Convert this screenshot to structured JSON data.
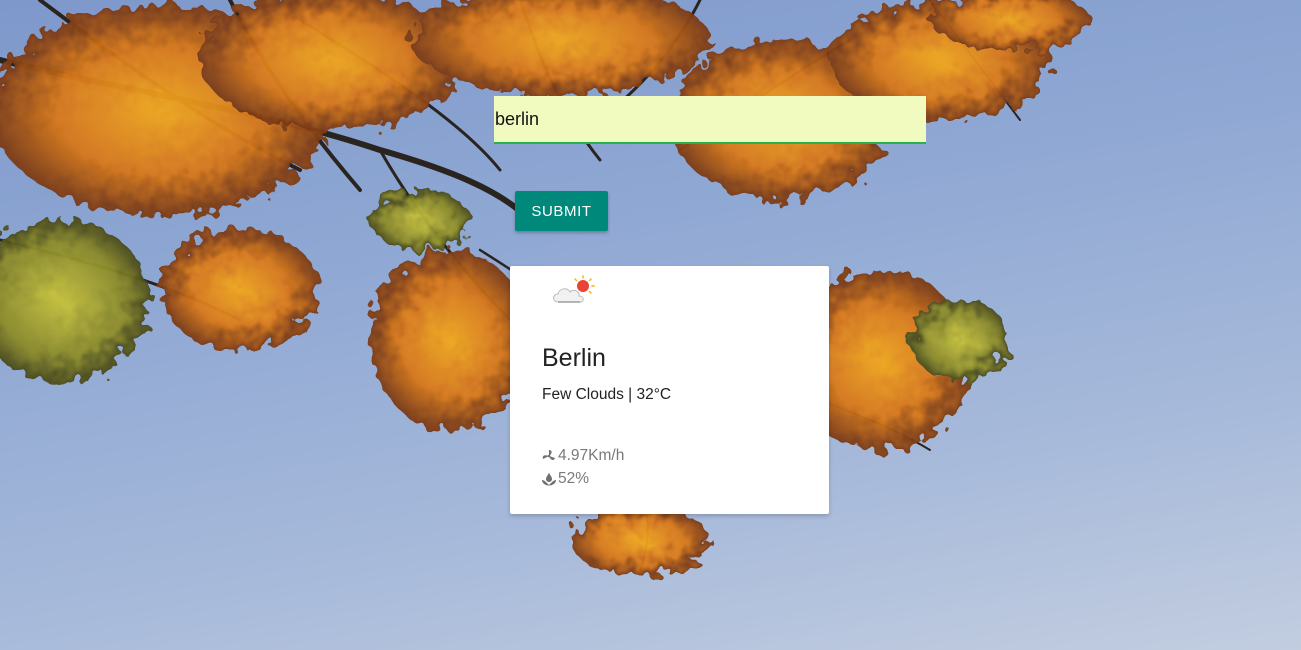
{
  "search": {
    "value": "berlin"
  },
  "submit": {
    "label": "SUBMIT"
  },
  "weather": {
    "city": "Berlin",
    "summary": "Few Clouds | 32°C",
    "wind": "4.97Km/h",
    "humidity": "52%",
    "icon": "few-clouds-day-icon"
  },
  "colors": {
    "accent": "#00897b",
    "input_background": "#f1fbbf",
    "input_underline": "#26b24a",
    "sky": "#8ea7d3",
    "foliage": "#e08a1e"
  }
}
